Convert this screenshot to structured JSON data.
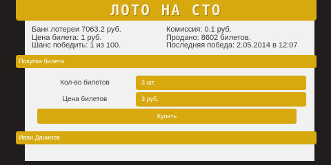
{
  "banner": {
    "title": "ЛОТО НА СТО"
  },
  "stats": {
    "bank": "Банк лотереи 7063.2 руб.",
    "ticket_price": "Цена билета: 1 руб.",
    "win_chance": "Шанс победить: 1 из 100.",
    "commission": "Комиссия: 0.1 руб.",
    "sold": "Продано: 8602 билетов.",
    "last_win": "Последняя победа: 2.05.2014 в 12:07"
  },
  "purchase": {
    "section_title": "Покупка билета",
    "quantity_label": "Кол-во билетов",
    "quantity_value": "3 шт.",
    "price_label": "Цена билетов",
    "price_value": "3 руб.",
    "buy_label": "Купить"
  },
  "user": {
    "name": "Иван Данилов"
  },
  "colors": {
    "accent": "#d7a90f",
    "background": "#211d1c",
    "panel": "#f1f1f1"
  }
}
